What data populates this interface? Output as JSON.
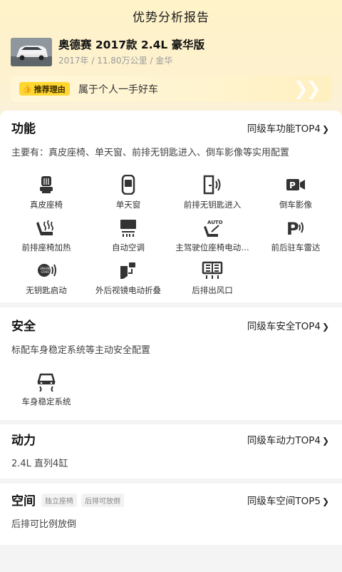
{
  "header": {
    "title": "优势分析报告"
  },
  "car": {
    "name": "奥德赛 2017款 2.4L 豪华版",
    "meta": "2017年 / 11.80万公里 / 金华"
  },
  "reason": {
    "badge": "推荐理由",
    "text": "属于个人一手好车"
  },
  "sections": {
    "function": {
      "title": "功能",
      "link": "同级车功能TOP4",
      "desc": "主要有：真皮座椅、单天窗、前排无钥匙进入、倒车影像等实用配置",
      "items": [
        {
          "label": "真皮座椅",
          "icon": "leather-seat-icon"
        },
        {
          "label": "单天窗",
          "icon": "sunroof-icon"
        },
        {
          "label": "前排无钥匙进入",
          "icon": "keyless-entry-icon"
        },
        {
          "label": "倒车影像",
          "icon": "reverse-camera-icon"
        },
        {
          "label": "前排座椅加热",
          "icon": "seat-heating-icon"
        },
        {
          "label": "自动空调",
          "icon": "auto-ac-icon"
        },
        {
          "label": "主驾驶位座椅电动…",
          "icon": "power-seat-icon"
        },
        {
          "label": "前后驻车雷达",
          "icon": "parking-radar-icon"
        },
        {
          "label": "无钥匙启动",
          "icon": "keyless-start-icon"
        },
        {
          "label": "外后视镜电动折叠",
          "icon": "mirror-fold-icon"
        },
        {
          "label": "后排出风口",
          "icon": "rear-vent-icon"
        }
      ]
    },
    "safety": {
      "title": "安全",
      "link": "同级车安全TOP4",
      "desc": "标配车身稳定系统等主动安全配置",
      "items": [
        {
          "label": "车身稳定系统",
          "icon": "stability-control-icon"
        }
      ]
    },
    "power": {
      "title": "动力",
      "link": "同级车动力TOP4",
      "desc": "2.4L 直列4缸"
    },
    "space": {
      "title": "空间",
      "link": "同级车空间TOP5",
      "tags": [
        "独立座椅",
        "后排可放倒"
      ],
      "desc": "后排可比例放倒"
    }
  },
  "colors": {
    "accent": "#ffd630",
    "hero_bg": "#fff3c9",
    "icon": "#333333"
  }
}
